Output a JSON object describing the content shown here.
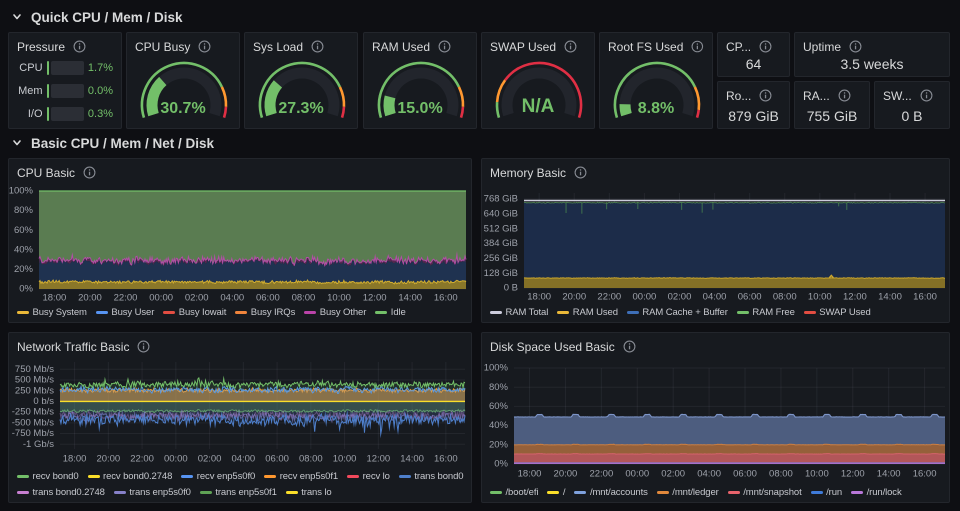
{
  "sections": [
    {
      "title": "Quick CPU / Mem / Disk"
    },
    {
      "title": "Basic CPU / Mem / Net / Disk"
    }
  ],
  "pressure": {
    "title": "Pressure",
    "rows": [
      {
        "label": "CPU",
        "value": "1.7%",
        "pct": 1.7
      },
      {
        "label": "Mem",
        "value": "0.0%",
        "pct": 0.0
      },
      {
        "label": "I/O",
        "value": "0.3%",
        "pct": 0.3
      }
    ]
  },
  "gauges": [
    {
      "title": "CPU Busy",
      "display": "30.7%",
      "value": 30.7,
      "thresholds": [
        80,
        93
      ]
    },
    {
      "title": "Sys Load",
      "display": "27.3%",
      "value": 27.3,
      "thresholds": [
        80,
        93
      ]
    },
    {
      "title": "RAM Used",
      "display": "15.0%",
      "value": 15.0,
      "thresholds": [
        80,
        93
      ]
    },
    {
      "title": "SWAP Used",
      "display": "N/A",
      "value": null,
      "thresholds": [
        10,
        25
      ]
    },
    {
      "title": "Root FS Used",
      "display": "8.8%",
      "value": 8.8,
      "thresholds": [
        80,
        95
      ]
    }
  ],
  "stats": [
    {
      "title": "CP...",
      "value": "64"
    },
    {
      "title": "Uptime",
      "value": "3.5 weeks"
    },
    {
      "title": "Ro...",
      "value": "879 GiB"
    },
    {
      "title": "RA...",
      "value": "755 GiB"
    },
    {
      "title": "SW...",
      "value": "0 B"
    }
  ],
  "colors": {
    "green": "#73BF69",
    "orange": "#FF9830",
    "red": "#E02F44",
    "text": "#d8d9da"
  },
  "time_ticks": [
    "18:00",
    "20:00",
    "22:00",
    "00:00",
    "02:00",
    "04:00",
    "06:00",
    "08:00",
    "10:00",
    "12:00",
    "14:00",
    "16:00"
  ],
  "chart_data": [
    {
      "id": "cpu_basic",
      "title": "CPU Basic",
      "type": "area",
      "stacked": true,
      "ylabel": "percent",
      "ylim": [
        0,
        100
      ],
      "y_tick_labels": [
        "100%",
        "80%",
        "60%",
        "40%",
        "20%",
        "0%"
      ],
      "y_tick_values": [
        100,
        80,
        60,
        40,
        20,
        0
      ],
      "series": [
        {
          "name": "Busy System",
          "color": "#EAB839",
          "fill": "#8a7729",
          "avg": 7.2,
          "noise": 1.6
        },
        {
          "name": "Busy User",
          "color": "#5794F2",
          "fill": "#1f3250",
          "avg": 19.5,
          "noise": 2.6
        },
        {
          "name": "Busy Iowait",
          "color": "#E24D42",
          "avg": 0.1,
          "noise": 0.1
        },
        {
          "name": "Busy IRQs",
          "color": "#EF843C",
          "avg": 0.1,
          "noise": 0.1
        },
        {
          "name": "Busy Other",
          "color": "#BA43A9",
          "fill": "#54284f",
          "avg": 2.2,
          "noise": 1.8,
          "spike": 3.5
        },
        {
          "name": "Idle",
          "color": "#73BF69",
          "fill": "#5a7c51",
          "avg": 70
        }
      ]
    },
    {
      "id": "memory_basic",
      "title": "Memory Basic",
      "type": "area",
      "ylabel": "bytes",
      "ylim": [
        0,
        790
      ],
      "y_tick_labels": [
        "768 GiB",
        "640 GiB",
        "512 GiB",
        "384 GiB",
        "256 GiB",
        "128 GiB",
        "0 B"
      ],
      "y_tick_values": [
        768,
        640,
        512,
        384,
        256,
        128,
        0
      ],
      "series": [
        {
          "name": "RAM Total",
          "color": "#CCCCDC",
          "value": 755
        },
        {
          "name": "RAM Used",
          "color": "#EAB839",
          "fill": "#847026",
          "avg": 86,
          "noise": 3
        },
        {
          "name": "RAM Cache + Buffer",
          "color": "#3E6FB8",
          "fill": "#1c2c49",
          "avg": 650,
          "noise": 3
        },
        {
          "name": "RAM Free",
          "color": "#73BF69",
          "avg": 16
        },
        {
          "name": "SWAP Used",
          "color": "#E24D42",
          "avg": 0
        }
      ]
    },
    {
      "id": "network_basic",
      "title": "Network Traffic Basic",
      "type": "line",
      "ylabel": "bitrate",
      "ylim": [
        -1150,
        950
      ],
      "y_tick_labels": [
        "750 Mb/s",
        "500 Mb/s",
        "250 Mb/s",
        "0 b/s",
        "-250 Mb/s",
        "-500 Mb/s",
        "-750 Mb/s",
        "-1 Gb/s"
      ],
      "y_tick_values": [
        750,
        500,
        250,
        0,
        -250,
        -500,
        -750,
        -1000
      ],
      "series": [
        {
          "name": "recv bond0",
          "color": "#73BF69",
          "avg": 390,
          "noise": 75,
          "spike": 130,
          "fillOp": 0.13
        },
        {
          "name": "recv bond0.2748",
          "color": "#FADE2A",
          "avg": 2,
          "noise": 0
        },
        {
          "name": "recv enp5s0f0",
          "color": "#5794F2",
          "avg": 275,
          "noise": 70,
          "fillOp": 0.15
        },
        {
          "name": "recv enp5s0f1",
          "color": "#FF9830",
          "avg": 258,
          "noise": 50,
          "fillOp": 0.55
        },
        {
          "name": "recv lo",
          "color": "#F2495C",
          "avg": 2,
          "noise": 0
        },
        {
          "name": "trans bond0",
          "color": "#4E7FCB",
          "avg": -430,
          "noise": 120,
          "spike": -270,
          "fillOp": 0.14
        },
        {
          "name": "trans bond0.2748",
          "color": "#C77FD1",
          "avg": -320,
          "noise": 85,
          "fillOp": 0
        },
        {
          "name": "trans enp5s0f0",
          "color": "#8680C8",
          "avg": -350,
          "noise": 100,
          "fillOp": 0.06
        },
        {
          "name": "trans enp5s0f1",
          "color": "#5FA255",
          "avg": -225,
          "noise": 30,
          "fillOp": 0.3
        },
        {
          "name": "trans lo",
          "color": "#FADE2A",
          "avg": -2,
          "noise": 0
        }
      ]
    },
    {
      "id": "disk_basic",
      "title": "Disk Space Used Basic",
      "type": "area",
      "ylabel": "percent",
      "ylim": [
        0,
        100
      ],
      "y_tick_labels": [
        "100%",
        "80%",
        "60%",
        "40%",
        "20%",
        "0%"
      ],
      "y_tick_values": [
        100,
        80,
        60,
        40,
        20,
        0
      ],
      "series": [
        {
          "name": "/boot/efi",
          "color": "#73BF69",
          "avg": 0.4
        },
        {
          "name": "/",
          "color": "#FADE2A",
          "avg": 2.0
        },
        {
          "name": "/mnt/accounts",
          "color": "#7EA0DC",
          "fill": "#4d5d7f",
          "avg": 49,
          "bump": 2.6
        },
        {
          "name": "/mnt/ledger",
          "color": "#E0883C",
          "fill": "#95603a",
          "avg": 20,
          "bump": 0.5
        },
        {
          "name": "/mnt/snapshot",
          "color": "#E8636C",
          "fill": "#b25659",
          "avg": 10.4,
          "bump": 0.35
        },
        {
          "name": "/run",
          "color": "#3F7BD9",
          "fill": "#2c3e66",
          "avg": 1.3
        },
        {
          "name": "/run/lock",
          "color": "#B877D9",
          "avg": 0.8
        }
      ]
    }
  ]
}
